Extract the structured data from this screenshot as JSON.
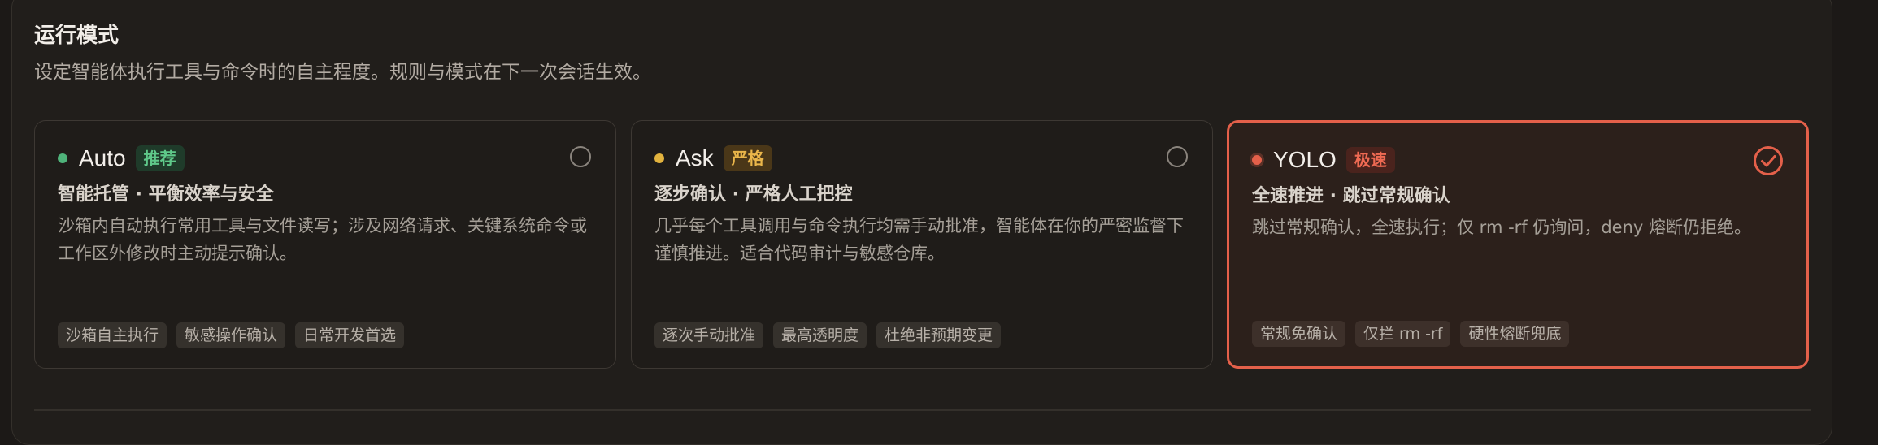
{
  "section": {
    "title": "运行模式",
    "subtitle": "设定智能体执行工具与命令时的自主程度。规则与模式在下一次会话生效。"
  },
  "colors": {
    "auto_dot": "#4fb37a",
    "ask_dot": "#e2b33e",
    "yolo_dot": "#e4604a",
    "accent": "#e4604a"
  },
  "modes": [
    {
      "name": "Auto",
      "badge": "推荐",
      "selected": false,
      "heading": "智能托管 · 平衡效率与安全",
      "description": "沙箱内自动执行常用工具与文件读写；涉及网络请求、关键系统命令或工作区外修改时主动提示确认。",
      "tags": [
        "沙箱自主执行",
        "敏感操作确认",
        "日常开发首选"
      ]
    },
    {
      "name": "Ask",
      "badge": "严格",
      "selected": false,
      "heading": "逐步确认 · 严格人工把控",
      "description": "几乎每个工具调用与命令执行均需手动批准，智能体在你的严密监督下谨慎推进。适合代码审计与敏感仓库。",
      "tags": [
        "逐次手动批准",
        "最高透明度",
        "杜绝非预期变更"
      ]
    },
    {
      "name": "YOLO",
      "badge": "极速",
      "selected": true,
      "selected_icon": "check-circle-icon",
      "heading": "全速推进 · 跳过常规确认",
      "description": "跳过常规确认，全速执行；仅 rm -rf 仍询问，deny 熔断仍拒绝。",
      "tags": [
        "常规免确认",
        "仅拦 rm -rf",
        "硬性熔断兜底"
      ]
    }
  ]
}
